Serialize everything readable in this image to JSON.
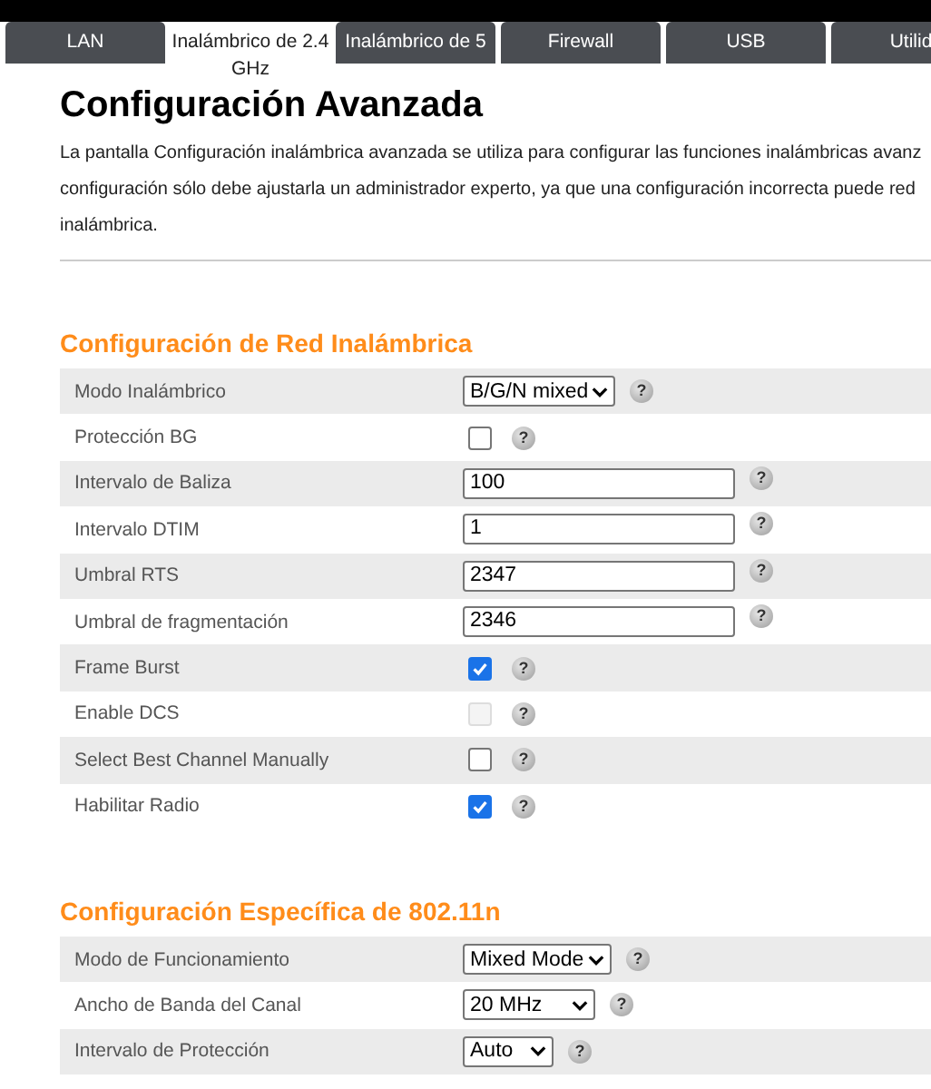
{
  "tabs": [
    {
      "label": "LAN",
      "selected": false
    },
    {
      "label": "Inalámbrico de 2.4 GHz",
      "selected": true
    },
    {
      "label": "Inalámbrico de 5",
      "selected": false
    },
    {
      "label": "Firewall",
      "selected": false
    },
    {
      "label": "USB",
      "selected": false
    },
    {
      "label": "Utilid",
      "selected": false
    }
  ],
  "title": "Configuración Avanzada",
  "description_lines": [
    "La pantalla Configuración inalámbrica avanzada se utiliza para configurar las funciones inalámbricas avanz",
    "configuración sólo debe ajustarla un administrador experto, ya que una configuración incorrecta puede red",
    "inalámbrica."
  ],
  "sections": [
    {
      "heading": "Configuración de Red Inalámbrica",
      "rows": [
        {
          "label": "Modo Inalámbrico",
          "kind": "select",
          "value": "B/G/N mixed",
          "help": "?"
        },
        {
          "label": "Protección BG",
          "kind": "checkbox",
          "checked": false,
          "disabled": false,
          "help": "?"
        },
        {
          "label": "Intervalo de Baliza",
          "kind": "text",
          "value": "100",
          "help": "?"
        },
        {
          "label": "Intervalo DTIM",
          "kind": "text",
          "value": "1",
          "help": "?"
        },
        {
          "label": "Umbral RTS",
          "kind": "text",
          "value": "2347",
          "help": "?"
        },
        {
          "label": "Umbral de fragmentación",
          "kind": "text",
          "value": "2346",
          "help": "?"
        },
        {
          "label": "Frame Burst",
          "kind": "checkbox",
          "checked": true,
          "disabled": false,
          "help": "?"
        },
        {
          "label": "Enable DCS",
          "kind": "checkbox",
          "checked": false,
          "disabled": true,
          "help": "?"
        },
        {
          "label": "Select Best Channel Manually",
          "kind": "checkbox",
          "checked": false,
          "disabled": false,
          "help": "?"
        },
        {
          "label": "Habilitar Radio",
          "kind": "checkbox",
          "checked": true,
          "disabled": false,
          "help": "?"
        }
      ]
    },
    {
      "heading": "Configuración Específica de 802.11n",
      "rows": [
        {
          "label": "Modo de Funcionamiento",
          "kind": "select",
          "value": "Mixed Mode",
          "help": "?"
        },
        {
          "label": "Ancho de Banda del Canal",
          "kind": "select",
          "value": "20 MHz",
          "help": "?"
        },
        {
          "label": "Intervalo de Protección",
          "kind": "select",
          "value": "Auto",
          "help": "?"
        }
      ]
    }
  ]
}
